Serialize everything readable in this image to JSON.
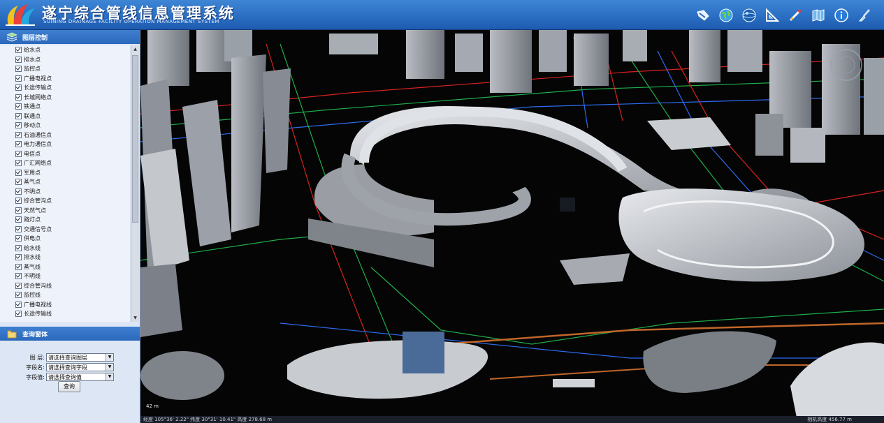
{
  "app": {
    "title": "遂宁综合管线信息管理系统",
    "subtitle": "SUINING DRAINAGE FACILITY OPERATION MANAGEMENT SYSTEM"
  },
  "toolbar": {
    "tools": [
      {
        "icon": "pipe-tool-icon"
      },
      {
        "icon": "globe-icon"
      },
      {
        "icon": "earth-view-icon"
      },
      {
        "icon": "measure-triangle-icon"
      },
      {
        "icon": "draw-tool-icon"
      },
      {
        "icon": "map-layer-icon"
      },
      {
        "icon": "info-icon"
      },
      {
        "icon": "clear-brush-icon"
      }
    ]
  },
  "layer_panel": {
    "title": "图层控制",
    "items": [
      {
        "label": "给水点",
        "checked": true
      },
      {
        "label": "排水点",
        "checked": true
      },
      {
        "label": "监控点",
        "checked": true
      },
      {
        "label": "广播电视点",
        "checked": true
      },
      {
        "label": "长途传输点",
        "checked": true
      },
      {
        "label": "长城网络点",
        "checked": true
      },
      {
        "label": "铁通点",
        "checked": true
      },
      {
        "label": "联通点",
        "checked": true
      },
      {
        "label": "移动点",
        "checked": true
      },
      {
        "label": "石油通信点",
        "checked": true
      },
      {
        "label": "电力通信点",
        "checked": true
      },
      {
        "label": "电信点",
        "checked": true
      },
      {
        "label": "广汇网络点",
        "checked": true
      },
      {
        "label": "军用点",
        "checked": true
      },
      {
        "label": "蒸气点",
        "checked": true
      },
      {
        "label": "不明点",
        "checked": true
      },
      {
        "label": "综合管沟点",
        "checked": true
      },
      {
        "label": "天然气点",
        "checked": true
      },
      {
        "label": "路灯点",
        "checked": true
      },
      {
        "label": "交通信号点",
        "checked": true
      },
      {
        "label": "供电点",
        "checked": true
      },
      {
        "label": "给水线",
        "checked": true
      },
      {
        "label": "排水线",
        "checked": true
      },
      {
        "label": "蒸气线",
        "checked": true
      },
      {
        "label": "不明线",
        "checked": true
      },
      {
        "label": "综合管沟线",
        "checked": true
      },
      {
        "label": "监控线",
        "checked": true
      },
      {
        "label": "广播电视线",
        "checked": true
      },
      {
        "label": "长途传输线",
        "checked": true
      }
    ]
  },
  "query_panel": {
    "title": "查询窗体",
    "layer_label": "图    层:",
    "layer_value": "请选择查询图层",
    "field_label": "字段名:",
    "field_value": "请选择查询字段",
    "value_label": "字段值:",
    "value_value": "请选择查询值",
    "button": "查询"
  },
  "map": {
    "scale_label": "42 m",
    "status_left": "经度 105°36' 2.22\"  纬度 30°31' 10.41\"  高度 278.68 m",
    "status_right": "相机高度 456.77 m"
  },
  "colors": {
    "header": "#2b6fc3",
    "panel": "#dde6f4",
    "pipe_red": "#d8231f",
    "pipe_green": "#1fae4a",
    "pipe_blue": "#2e6cf0",
    "pipe_orange": "#c0662a"
  }
}
